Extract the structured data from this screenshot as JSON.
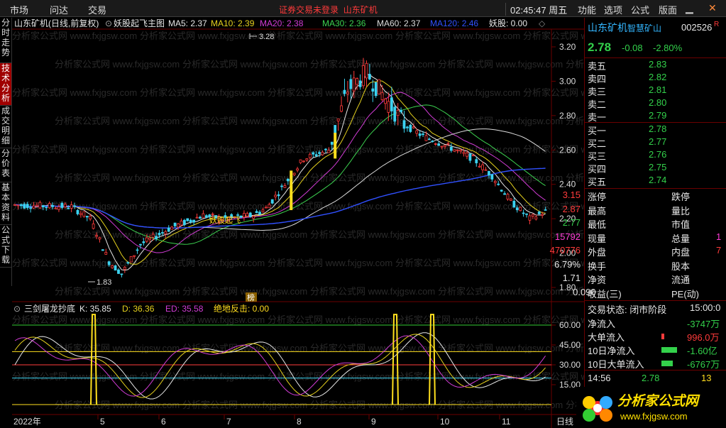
{
  "menu": {
    "left": [
      "市场",
      "问达",
      "交易"
    ],
    "notice1": "证券交易未登录",
    "notice2": "山东矿机",
    "time": "02:45:47",
    "weekday": "周五",
    "right": [
      "功能",
      "选项",
      "公式",
      "版面"
    ]
  },
  "sidebar": [
    "分时走势",
    "技术分析",
    "成交明细",
    "分价表",
    "基本资料",
    "公式下载"
  ],
  "main_legend": {
    "stock": "山东矿机(日线,前复权)",
    "formula": "妖股起飞主图",
    "ma5": "MA5: 2.37",
    "ma10": "MA10: 2.39",
    "ma20": "MA20: 2.38",
    "ma30": "MA30: 2.36",
    "ma60": "MA60: 2.37",
    "ma120": "MA120: 2.46",
    "yao": "妖股: 0.00"
  },
  "price_axis": [
    "3.20",
    "3.00",
    "2.80",
    "2.60",
    "2.40",
    "2.20",
    "2.00",
    "1.80"
  ],
  "annotations": {
    "high": "3.28",
    "low": "1.83",
    "signal": "妖股起飞",
    "bang": "榜"
  },
  "sub_legend": {
    "name": "三剑屠龙抄底",
    "k": "K: 35.85",
    "d": "D: 36.36",
    "ed": "ED: 35.58",
    "jd": "绝地反击: 0.00"
  },
  "sub_axis": [
    "60.00",
    "45.00",
    "30.00",
    "15.00"
  ],
  "date_axis": {
    "year": "2022年",
    "months": [
      "5",
      "6",
      "7",
      "8",
      "9",
      "10",
      "11"
    ],
    "period": "日线"
  },
  "quote": {
    "name": "山东矿机",
    "tag": "智慧矿山",
    "code": "002526",
    "r": "R",
    "price": "2.78",
    "change": "-0.08",
    "pct": "-2.80%"
  },
  "asks": [
    {
      "l": "卖五",
      "p": "2.83"
    },
    {
      "l": "卖四",
      "p": "2.82"
    },
    {
      "l": "卖三",
      "p": "2.81"
    },
    {
      "l": "卖二",
      "p": "2.80"
    },
    {
      "l": "卖一",
      "p": "2.79"
    }
  ],
  "bids": [
    {
      "l": "买一",
      "p": "2.78"
    },
    {
      "l": "买二",
      "p": "2.77"
    },
    {
      "l": "买三",
      "p": "2.76"
    },
    {
      "l": "买四",
      "p": "2.75"
    },
    {
      "l": "买五",
      "p": "2.74"
    }
  ],
  "stats": [
    {
      "l": "涨停",
      "v": "3.15",
      "c": "red",
      "l2": "跌停"
    },
    {
      "l": "最高",
      "v": "2.87",
      "c": "red",
      "l2": "量比"
    },
    {
      "l": "最低",
      "v": "2.77",
      "c": "green",
      "l2": "市值"
    },
    {
      "l": "现量",
      "v": "15792",
      "c": "mag",
      "l2": "总量",
      "v2": "1"
    },
    {
      "l": "外盘",
      "v": "470776",
      "c": "red",
      "l2": "内盘",
      "v2": "7"
    },
    {
      "l": "换手",
      "v": "6.79%",
      "c": "white",
      "l2": "股本"
    },
    {
      "l": "净资",
      "v": "1.71",
      "c": "white",
      "l2": "流通"
    },
    {
      "l": "收益(三)",
      "v": "0.090",
      "c": "white",
      "l2": "PE(动)"
    }
  ],
  "trade_status": {
    "label": "交易状态: 闭市阶段",
    "time": "15:00:0"
  },
  "flows": [
    {
      "l": "净流入",
      "v": "-3747万",
      "c": "green"
    },
    {
      "l": "大单流入",
      "v": "996.0万",
      "c": "red"
    },
    {
      "l": "10日净流入",
      "v": "-1.60亿",
      "c": "green"
    },
    {
      "l": "10日大单流入",
      "v": "-6767万",
      "c": "green"
    }
  ],
  "tick": {
    "time": "14:56",
    "price": "2.78",
    "vol": "13"
  },
  "logo": {
    "cn": "分析家公式网",
    "url": "www.fxjgsw.com"
  }
}
